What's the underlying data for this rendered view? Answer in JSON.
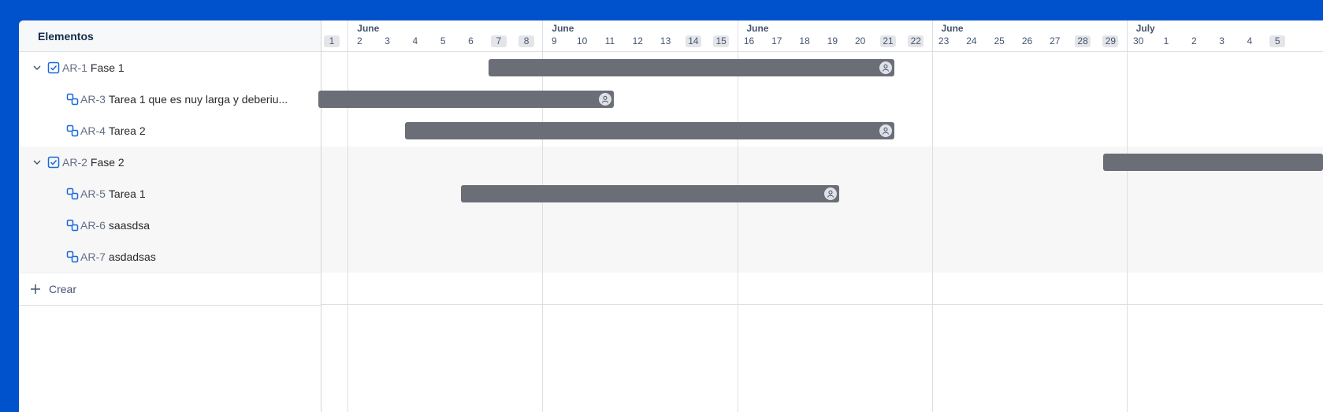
{
  "list": {
    "header": "Elementos",
    "rows": [
      {
        "key": "AR-1",
        "title": "Fase 1",
        "type": "epic"
      },
      {
        "key": "AR-3",
        "title": "Tarea 1 que es nuy larga y deberiu...",
        "type": "subtask"
      },
      {
        "key": "AR-4",
        "title": "Tarea 2",
        "type": "subtask"
      },
      {
        "key": "AR-2",
        "title": "Fase 2",
        "type": "epic"
      },
      {
        "key": "AR-5",
        "title": "Tarea 1",
        "type": "subtask"
      },
      {
        "key": "AR-6",
        "title": "saasdsa",
        "type": "subtask"
      },
      {
        "key": "AR-7",
        "title": "asdadsas",
        "type": "subtask"
      }
    ],
    "create_label": "Crear"
  },
  "timeline": {
    "months": [
      "June",
      "June",
      "June",
      "June",
      "July"
    ],
    "days": [
      "1",
      "2",
      "3",
      "4",
      "5",
      "6",
      "7",
      "8",
      "9",
      "10",
      "11",
      "12",
      "13",
      "14",
      "15",
      "16",
      "17",
      "18",
      "19",
      "20",
      "21",
      "22",
      "23",
      "24",
      "25",
      "26",
      "27",
      "28",
      "29",
      "30",
      "1",
      "2",
      "3",
      "4",
      "5"
    ],
    "weekend_days": [
      "1",
      "7",
      "8",
      "14",
      "15",
      "21",
      "22",
      "28",
      "29",
      "5"
    ],
    "bars": [
      {
        "item": "AR-1",
        "start": "7",
        "end": "21",
        "assignee_icon": "person-icon"
      },
      {
        "item": "AR-3",
        "start": "1",
        "end": "11",
        "assignee_icon": "person-icon"
      },
      {
        "item": "AR-4",
        "start": "4",
        "end": "21",
        "assignee_icon": "person-icon"
      },
      {
        "item": "AR-2",
        "start": "29",
        "end": "5+",
        "assignee_icon": ""
      },
      {
        "item": "AR-5",
        "start": "6",
        "end": "19",
        "assignee_icon": "person-icon"
      }
    ]
  },
  "colors": {
    "background": "#0052cc",
    "bar": "#6b6e76",
    "icon_blue": "#1868db"
  }
}
